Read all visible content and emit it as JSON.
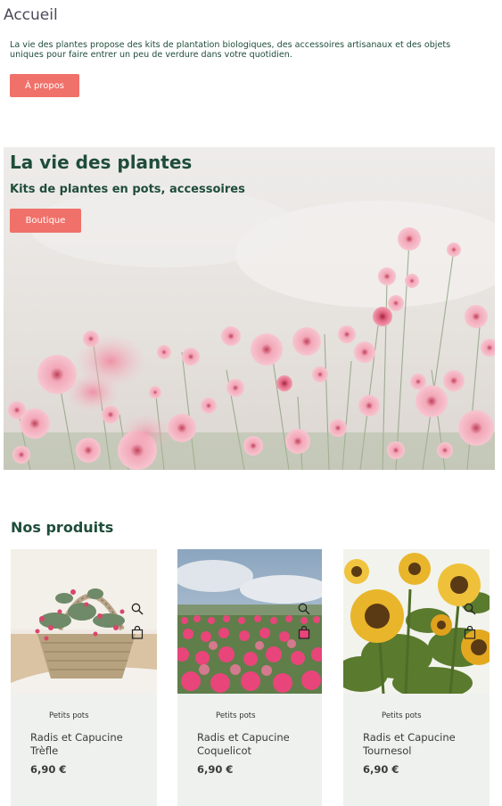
{
  "header": {
    "title": "Accueil"
  },
  "intro": {
    "text": "La vie des plantes propose des kits de plantation biologiques, des accessoires artisanaux et des objets uniques pour faire entrer un peu de verdure dans votre quotidien.",
    "button_label": "À propos"
  },
  "hero": {
    "title": "La vie des plantes",
    "subtitle": "Kits de plantes en pots, accessoires",
    "button_label": "Boutique"
  },
  "products": {
    "title": "Nos produits",
    "items": [
      {
        "category": "Petits pots",
        "name": "Radis et Capucine Trèfle",
        "price": "6,90 €"
      },
      {
        "category": "Petits pots",
        "name": "Radis et Capucine Coquelicot",
        "price": "6,90 €"
      },
      {
        "category": "Petits pots",
        "name": "Radis et Capucine Tournesol",
        "price": "6,90 €"
      }
    ]
  },
  "colors": {
    "accent": "#f0716a",
    "brand_green": "#1f4d3a",
    "card_bg": "#eef1ee"
  },
  "icons": [
    "search-icon",
    "shopping-bag-icon"
  ]
}
